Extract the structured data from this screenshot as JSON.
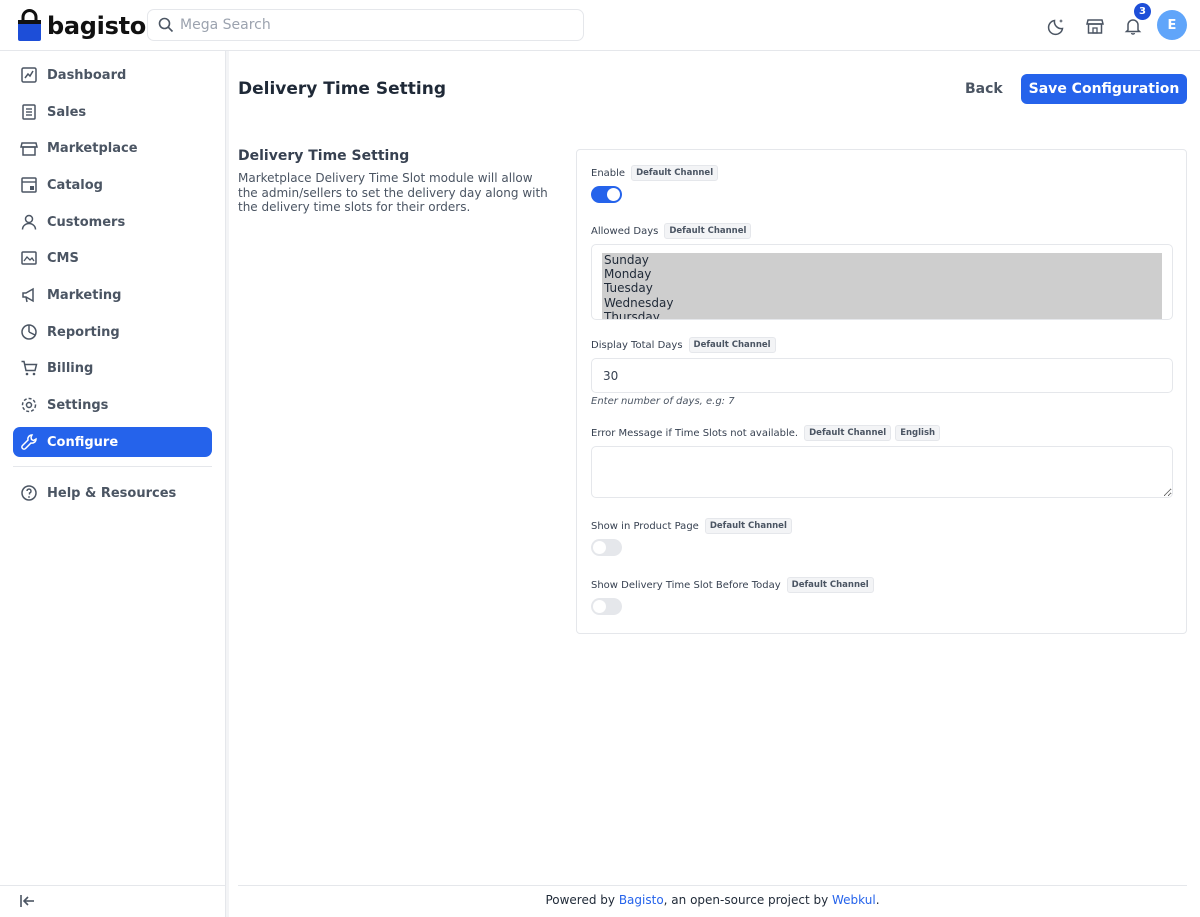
{
  "header": {
    "logo_text": "bagisto",
    "search_placeholder": "Mega Search",
    "notification_count": "3",
    "avatar_initial": "E",
    "accent_color": "#2563eb"
  },
  "sidebar": {
    "items": [
      {
        "label": "Dashboard",
        "icon": "dashboard-icon"
      },
      {
        "label": "Sales",
        "icon": "sales-icon"
      },
      {
        "label": "Marketplace",
        "icon": "store-icon"
      },
      {
        "label": "Catalog",
        "icon": "catalog-icon"
      },
      {
        "label": "Customers",
        "icon": "user-icon"
      },
      {
        "label": "CMS",
        "icon": "cms-icon"
      },
      {
        "label": "Marketing",
        "icon": "megaphone-icon"
      },
      {
        "label": "Reporting",
        "icon": "pie-chart-icon"
      },
      {
        "label": "Billing",
        "icon": "cart-icon"
      },
      {
        "label": "Settings",
        "icon": "gear-icon"
      },
      {
        "label": "Configure",
        "icon": "wrench-icon",
        "active": true
      }
    ],
    "help_label": "Help & Resources"
  },
  "page": {
    "title": "Delivery Time Setting",
    "back_label": "Back",
    "save_label": "Save Configuration"
  },
  "section": {
    "title": "Delivery Time Setting",
    "description": "Marketplace Delivery Time Slot module will allow the admin/sellers to set the delivery day along with the delivery time slots for their orders."
  },
  "fields": {
    "enable": {
      "label": "Enable",
      "chip": "Default Channel",
      "value": true
    },
    "allowed_days": {
      "label": "Allowed Days",
      "chip": "Default Channel",
      "options": [
        "Sunday",
        "Monday",
        "Tuesday",
        "Wednesday",
        "Thursday"
      ]
    },
    "total_days": {
      "label": "Display Total Days",
      "chip": "Default Channel",
      "value": "30",
      "hint": "Enter number of days, e.g: 7"
    },
    "error_message": {
      "label": "Error Message if Time Slots not available.",
      "chip": "Default Channel",
      "chip2": "English",
      "value": ""
    },
    "show_product_page": {
      "label": "Show in Product Page",
      "chip": "Default Channel",
      "value": false
    },
    "show_before_today": {
      "label": "Show Delivery Time Slot Before Today",
      "chip": "Default Channel",
      "value": false
    }
  },
  "footer": {
    "prefix": "Powered by ",
    "link1": "Bagisto",
    "middle": ", an open-source project by ",
    "link2": "Webkul",
    "suffix": "."
  }
}
